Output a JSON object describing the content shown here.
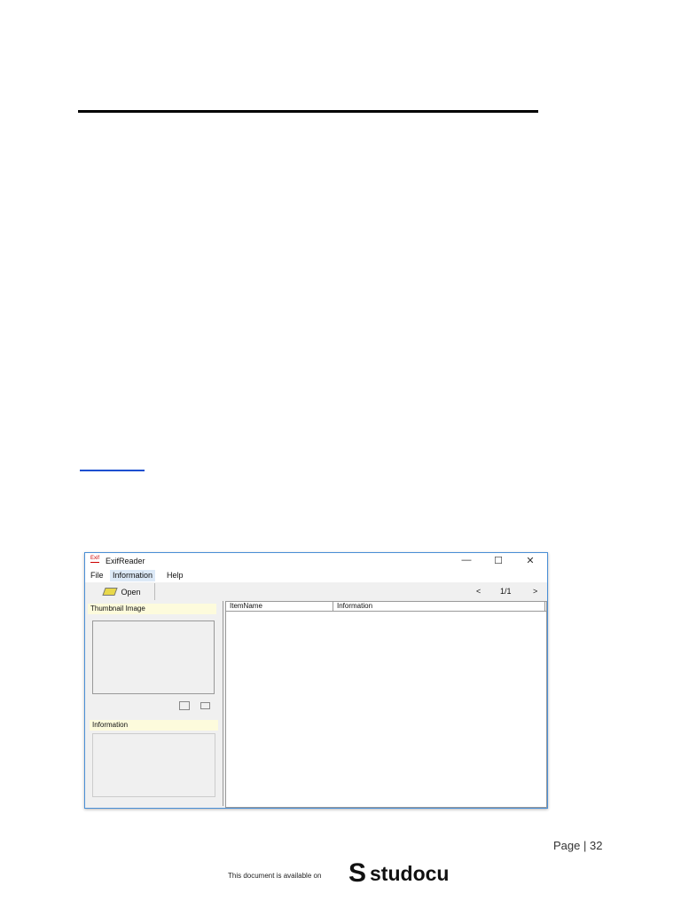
{
  "window": {
    "title": "ExifReader",
    "icon_text": "Exif",
    "menu": [
      "File",
      "Information",
      "Help"
    ],
    "toolbar": {
      "open": "Open",
      "prev": "<",
      "page": "1/1",
      "next": ">"
    },
    "left": {
      "thumbnail_label": "Thumbnail Image",
      "information_label": "Information"
    },
    "list": {
      "columns": [
        "ItemName",
        "Information"
      ]
    }
  },
  "footer": {
    "page": "Page | 32",
    "available": "This document is available on",
    "brand": "studocu"
  }
}
